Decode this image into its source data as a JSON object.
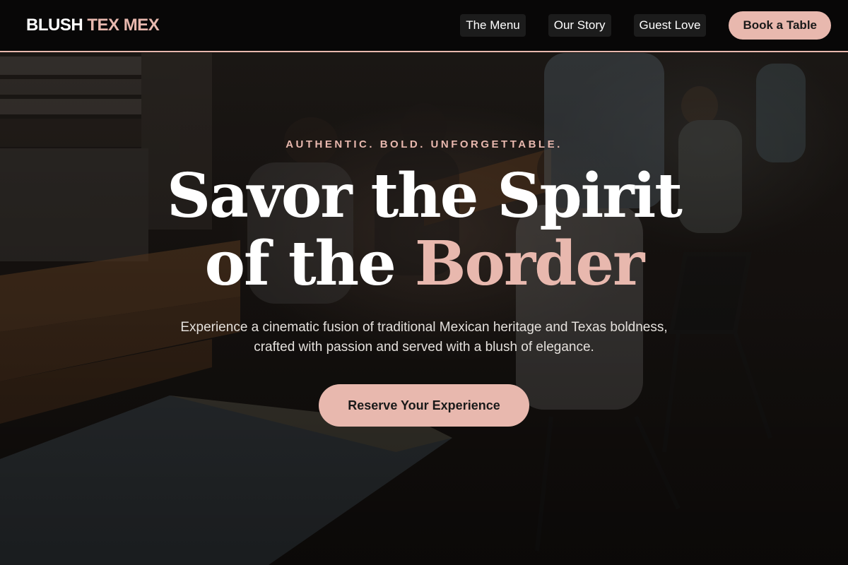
{
  "brand": {
    "name_primary": "BLUSH",
    "name_accent": "TEX MEX"
  },
  "nav": {
    "links": [
      {
        "label": "The Menu"
      },
      {
        "label": "Our Story"
      },
      {
        "label": "Guest Love"
      }
    ],
    "cta_label": "Book a Table"
  },
  "hero": {
    "tagline": "AUTHENTIC. BOLD. UNFORGETTABLE.",
    "headline_line1": "Savor the Spirit",
    "headline_line2_prefix": "of the",
    "headline_line2_accent": "Border",
    "subtext": "Experience a cinematic fusion of traditional Mexican heritage and Texas boldness, crafted with passion and served with a blush of elegance.",
    "cta_label": "Reserve Your Experience"
  },
  "colors": {
    "accent": "#e8b8ae",
    "header_bg": "#060606",
    "text_light": "#ffffff"
  }
}
